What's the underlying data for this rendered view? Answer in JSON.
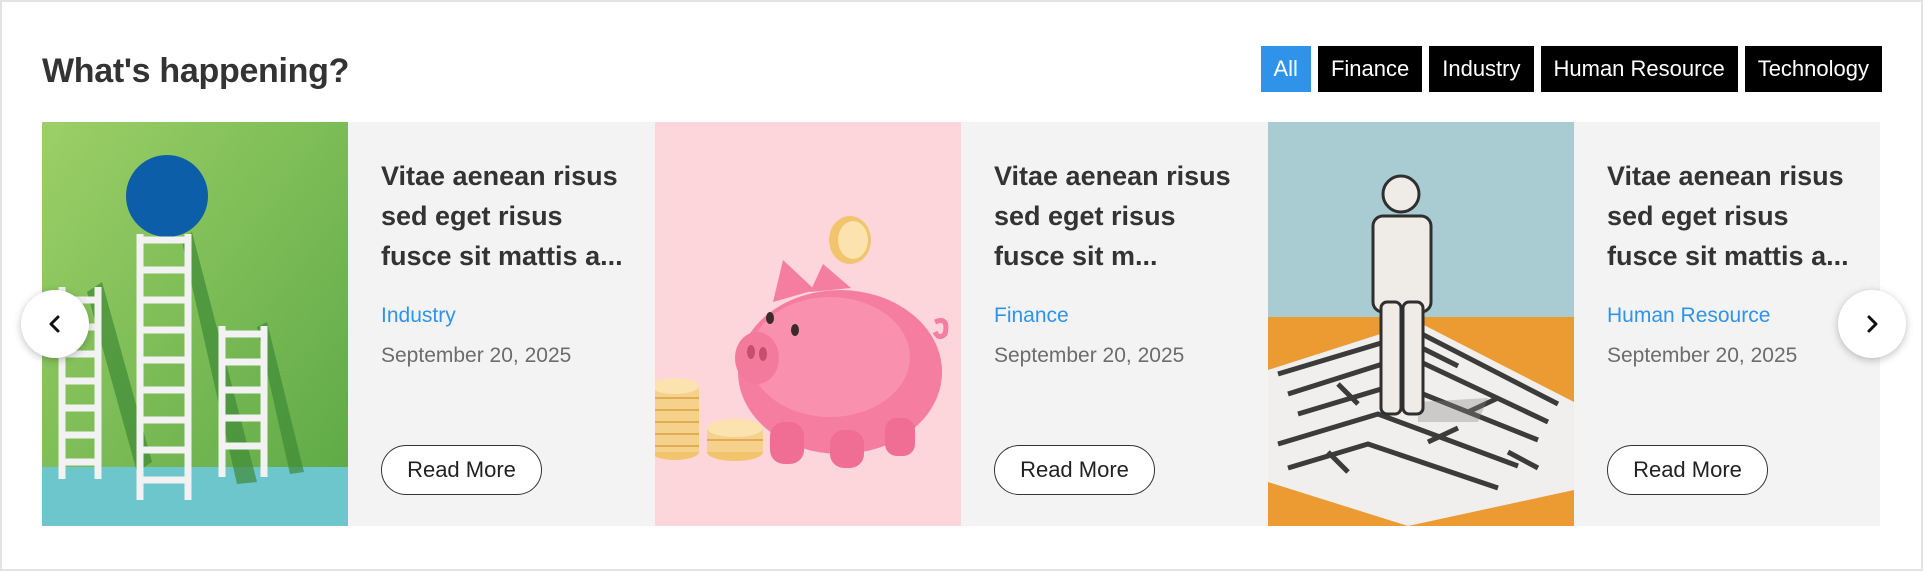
{
  "section": {
    "title": "What's happening?"
  },
  "filters": [
    {
      "label": "All",
      "active": true
    },
    {
      "label": "Finance",
      "active": false
    },
    {
      "label": "Industry",
      "active": false
    },
    {
      "label": "Human Resource",
      "active": false
    },
    {
      "label": "Technology",
      "active": false
    }
  ],
  "cards": [
    {
      "image": "ladders-blue-circle-image",
      "title": "Vitae aenean risus sed eget risus fusce sit mattis a...",
      "category": "Industry",
      "date": "September 20, 2025",
      "button": "Read More"
    },
    {
      "image": "piggy-bank-coins-image",
      "title": "Vitae aenean risus sed eget risus fusce sit m...",
      "category": "Finance",
      "date": "September 20, 2025",
      "button": "Read More"
    },
    {
      "image": "figure-on-maze-image",
      "title": "Vitae aenean risus sed eget risus fusce sit mattis a...",
      "category": "Human Resource",
      "date": "September 20, 2025",
      "button": "Read More"
    }
  ],
  "carousel": {
    "prev_icon": "chevron-left-icon",
    "next_icon": "chevron-right-icon"
  },
  "colors": {
    "accent": "#2f94e9",
    "filter_bg": "#000000",
    "card_bg": "#f3f3f3",
    "text": "#333333"
  }
}
